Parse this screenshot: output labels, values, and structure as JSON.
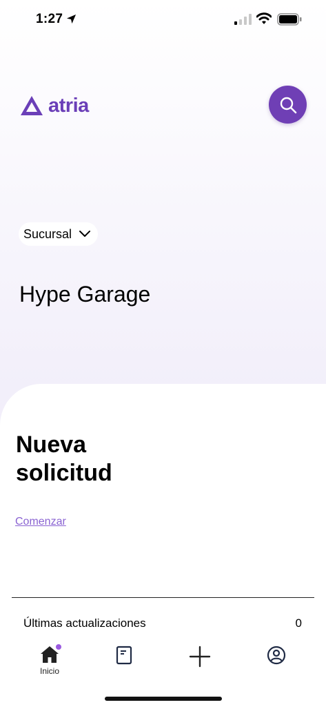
{
  "status_bar": {
    "time": "1:27",
    "icons": [
      "location-arrow-icon",
      "cellular-signal-icon",
      "wifi-icon",
      "battery-icon"
    ]
  },
  "header": {
    "logo_text": "atria",
    "search_icon": "search-icon"
  },
  "branch": {
    "selector_label": "Sucursal",
    "selected_name": "Hype Garage"
  },
  "card": {
    "title_line1": "Nueva",
    "title_line2": "solicitud",
    "start_link": "Comenzar"
  },
  "updates": {
    "label": "Últimas actualizaciones",
    "count": "0"
  },
  "tab_bar": {
    "tabs": [
      {
        "icon": "home-icon",
        "label": "Inicio",
        "badge": true
      },
      {
        "icon": "document-icon",
        "label": ""
      },
      {
        "icon": "plus-icon",
        "label": ""
      },
      {
        "icon": "user-icon",
        "label": ""
      }
    ]
  },
  "colors": {
    "accent": "#6f3fb5",
    "link": "#8a63d2",
    "badge": "#9b5be0"
  }
}
